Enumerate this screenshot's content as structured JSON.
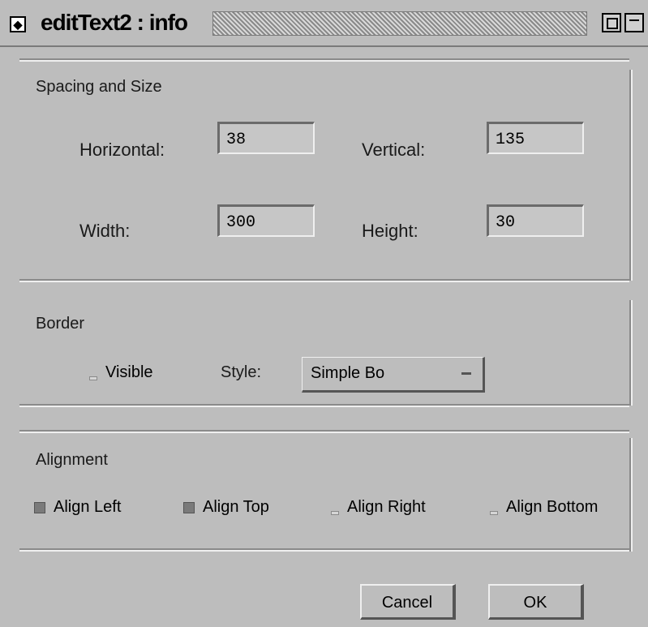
{
  "window": {
    "title": "editText2 : info"
  },
  "spacing": {
    "section_label": "Spacing and Size",
    "horizontal_label": "Horizontal:",
    "horizontal_value": "38",
    "vertical_label": "Vertical:",
    "vertical_value": "135",
    "width_label": "Width:",
    "width_value": "300",
    "height_label": "Height:",
    "height_value": "30"
  },
  "border": {
    "section_label": "Border",
    "visible_label": "Visible",
    "style_label": "Style:",
    "style_value": "Simple Bo"
  },
  "alignment": {
    "section_label": "Alignment",
    "options": [
      "Align Left",
      "Align Top",
      "Align Right",
      "Align Bottom"
    ]
  },
  "buttons": {
    "cancel": "Cancel",
    "ok": "OK"
  }
}
